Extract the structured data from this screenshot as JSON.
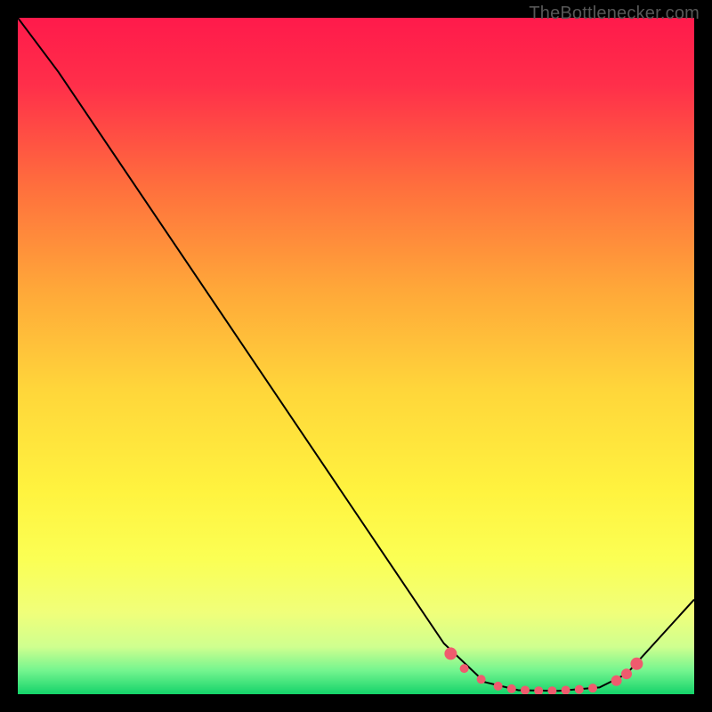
{
  "watermark": "TheBottlenecker.com",
  "chart_data": {
    "type": "line",
    "title": "",
    "xlabel": "",
    "ylabel": "",
    "xlim": [
      0,
      100
    ],
    "ylim": [
      0,
      100
    ],
    "grid": false,
    "legend": false,
    "annotations": [],
    "background_gradient_stops": [
      {
        "offset": 0.0,
        "color": "#ff1a4b"
      },
      {
        "offset": 0.1,
        "color": "#ff2f4a"
      },
      {
        "offset": 0.25,
        "color": "#ff6f3d"
      },
      {
        "offset": 0.4,
        "color": "#ffa739"
      },
      {
        "offset": 0.55,
        "color": "#ffd63a"
      },
      {
        "offset": 0.7,
        "color": "#fff33f"
      },
      {
        "offset": 0.8,
        "color": "#fbff54"
      },
      {
        "offset": 0.88,
        "color": "#f0ff7a"
      },
      {
        "offset": 0.93,
        "color": "#cfff8f"
      },
      {
        "offset": 0.965,
        "color": "#74f58f"
      },
      {
        "offset": 1.0,
        "color": "#14d36a"
      }
    ],
    "series": [
      {
        "name": "bottleneck-curve",
        "color": "#000000",
        "points": [
          {
            "x": 0.0,
            "y": 100.0
          },
          {
            "x": 6.0,
            "y": 92.0
          },
          {
            "x": 63.0,
            "y": 7.5
          },
          {
            "x": 69.0,
            "y": 1.8
          },
          {
            "x": 74.0,
            "y": 0.6
          },
          {
            "x": 80.0,
            "y": 0.5
          },
          {
            "x": 86.0,
            "y": 1.0
          },
          {
            "x": 90.0,
            "y": 3.0
          },
          {
            "x": 100.0,
            "y": 14.0
          }
        ]
      }
    ],
    "highlight_markers": {
      "name": "sweet-spot-markers",
      "color": "#ef5b6e",
      "radius_default": 6,
      "points": [
        {
          "x": 64.0,
          "y": 6.0,
          "r": 7
        },
        {
          "x": 66.0,
          "y": 3.8,
          "r": 5
        },
        {
          "x": 68.5,
          "y": 2.2,
          "r": 5
        },
        {
          "x": 71.0,
          "y": 1.2,
          "r": 5
        },
        {
          "x": 73.0,
          "y": 0.8,
          "r": 5
        },
        {
          "x": 75.0,
          "y": 0.6,
          "r": 5
        },
        {
          "x": 77.0,
          "y": 0.5,
          "r": 5
        },
        {
          "x": 79.0,
          "y": 0.5,
          "r": 5
        },
        {
          "x": 81.0,
          "y": 0.6,
          "r": 5
        },
        {
          "x": 83.0,
          "y": 0.7,
          "r": 5
        },
        {
          "x": 85.0,
          "y": 0.9,
          "r": 5
        },
        {
          "x": 88.5,
          "y": 2.0,
          "r": 6
        },
        {
          "x": 90.0,
          "y": 3.0,
          "r": 6
        },
        {
          "x": 91.5,
          "y": 4.5,
          "r": 7
        }
      ]
    }
  }
}
